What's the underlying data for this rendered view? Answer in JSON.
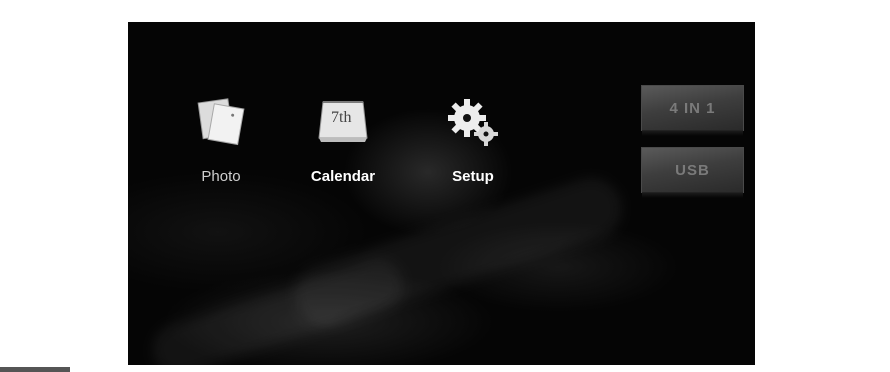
{
  "menu": {
    "items": [
      {
        "label": "Photo",
        "icon": "photo-icon"
      },
      {
        "label": "Calendar",
        "icon": "calendar-icon",
        "icon_text": "7th"
      },
      {
        "label": "Setup",
        "icon": "gear-icon"
      }
    ]
  },
  "sources": {
    "buttons": [
      {
        "label": "4 IN 1"
      },
      {
        "label": "USB"
      }
    ]
  },
  "colors": {
    "background": "#050505",
    "label": "#ffffff",
    "source_button": "#4a4a4a",
    "page": "#ffffff"
  }
}
